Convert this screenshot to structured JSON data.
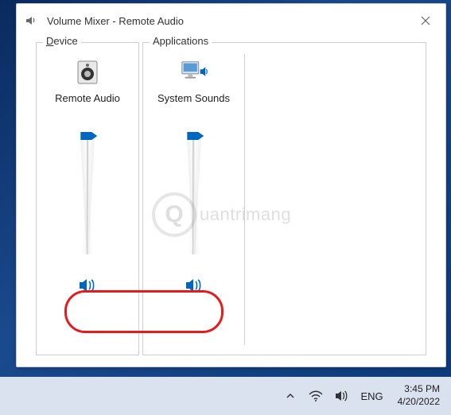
{
  "window": {
    "title": "Volume Mixer - Remote Audio"
  },
  "device_section": {
    "label_prefix": "D",
    "label_rest": "evice",
    "channel": {
      "name": "Remote Audio",
      "volume": 100
    }
  },
  "apps_section": {
    "label": "Applications",
    "channels": [
      {
        "name": "System Sounds",
        "volume": 100
      }
    ]
  },
  "watermark": {
    "glyph": "Q",
    "text": "uantrimang"
  },
  "taskbar": {
    "language": "ENG",
    "time": "3:45 PM",
    "date": "4/20/2022"
  },
  "colors": {
    "accent": "#0067c0",
    "highlight": "#e51c1c"
  }
}
